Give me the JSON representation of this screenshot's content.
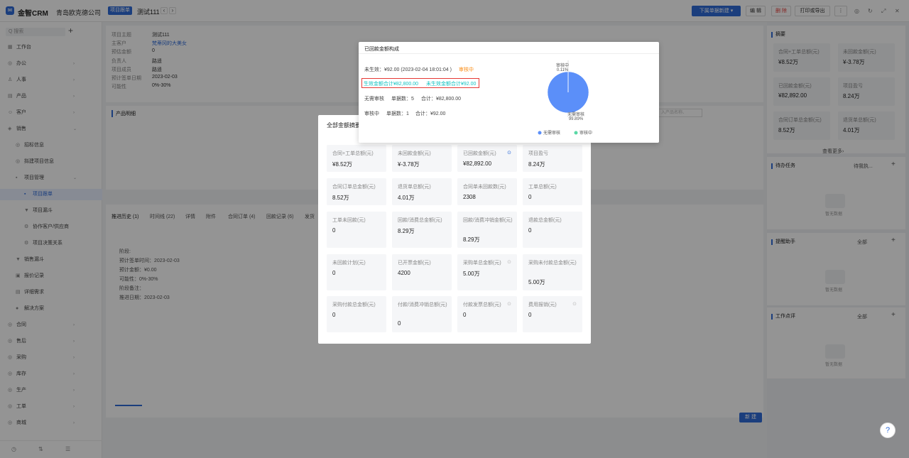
{
  "topbar": {
    "app_name": "金智CRM",
    "company": "青岛欧克德公司",
    "module_tag": "项目跟单",
    "record_title": "测试111",
    "prev": "‹",
    "next": "›",
    "btn_new": "下属单据新建 ▾",
    "btn_edit": "编 辑",
    "btn_delete": "删 除",
    "btn_print": "打印或导出",
    "btn_more": "⋮"
  },
  "sidebar": {
    "search_placeholder": "Q 搜索",
    "plus": "+",
    "items": [
      {
        "label": "工作台",
        "icon": "▦",
        "chevron": ""
      },
      {
        "label": "办公",
        "icon": "◎",
        "chevron": "›"
      },
      {
        "label": "人事",
        "icon": "♙",
        "chevron": "›"
      },
      {
        "label": "产品",
        "icon": "▤",
        "chevron": "›"
      },
      {
        "label": "客户",
        "icon": "☺",
        "chevron": "›"
      },
      {
        "label": "销售",
        "icon": "◈",
        "chevron": "⌄"
      },
      {
        "label": "招标信息",
        "icon": "◎",
        "chevron": ""
      },
      {
        "label": "拟建项目信息",
        "icon": "◎",
        "chevron": ""
      },
      {
        "label": "项目管理",
        "icon": "▪",
        "chevron": "⌄"
      },
      {
        "label": "项目跟单",
        "icon": "▪",
        "chevron": ""
      },
      {
        "label": "项目漏斗",
        "icon": "▼",
        "chevron": ""
      },
      {
        "label": "协作客户/供应商",
        "icon": "⚙",
        "chevron": ""
      },
      {
        "label": "项目决策关系",
        "icon": "⚙",
        "chevron": ""
      },
      {
        "label": "销售漏斗",
        "icon": "▼",
        "chevron": ""
      },
      {
        "label": "报价记录",
        "icon": "▣",
        "chevron": ""
      },
      {
        "label": "详细需求",
        "icon": "▤",
        "chevron": ""
      },
      {
        "label": "解决方案",
        "icon": "●",
        "chevron": ""
      },
      {
        "label": "合同",
        "icon": "◎",
        "chevron": "›"
      },
      {
        "label": "售后",
        "icon": "◎",
        "chevron": "›"
      },
      {
        "label": "采购",
        "icon": "◎",
        "chevron": "›"
      },
      {
        "label": "库存",
        "icon": "◎",
        "chevron": "›"
      },
      {
        "label": "生产",
        "icon": "◎",
        "chevron": "›"
      },
      {
        "label": "工单",
        "icon": "◎",
        "chevron": "›"
      },
      {
        "label": "商城",
        "icon": "◎",
        "chevron": "›"
      }
    ]
  },
  "detail": {
    "fields": [
      {
        "label": "项目主题",
        "value": "测试111"
      },
      {
        "label": "主客户",
        "value": "梵蒂冈的大美女"
      },
      {
        "label": "预估金额",
        "value": "0"
      },
      {
        "label": "负责人",
        "value": "路遥"
      },
      {
        "label": "项目成员",
        "value": "路遥"
      },
      {
        "label": "预计签单日期",
        "value": "2023-02-03"
      },
      {
        "label": "可能性",
        "value": "0%-30%"
      }
    ],
    "product_section": "产品明细",
    "product_search": "入产品名称、",
    "tabs": [
      "推进历史 (1)",
      "时间线 (22)",
      "详情",
      "附件",
      "合同订单 (4)",
      "回款记录 (6)",
      "发货"
    ],
    "new_btn": "新 建",
    "stage_lines": [
      "阶段:",
      "预计签单时间：2023-02-03",
      "预计金额：¥0.00",
      "可能性：0%-30%",
      "阶段备注：",
      "推进日期：2023-02-03"
    ]
  },
  "right_panel": {
    "summary_title": "摘要",
    "summary": [
      {
        "label": "合同+工单总额(元)",
        "value": "¥8.52万"
      },
      {
        "label": "未回款金额(元)",
        "value": "¥-3.78万"
      },
      {
        "label": "已回款金额(元)",
        "value": "¥82,892.00"
      },
      {
        "label": "项目盈亏",
        "value": "8.24万"
      },
      {
        "label": "合同订单总金额(元)",
        "value": "8.52万"
      },
      {
        "label": "退货单总额(元)",
        "value": "4.01万"
      }
    ],
    "view_more": "查看更多›",
    "todo_title": "待办任务",
    "todo_filter": "待我执...",
    "remind_title": "提醒助手",
    "remind_filter": "全部",
    "comment_title": "工作点评",
    "comment_filter": "全部",
    "empty": "暂无数据",
    "plus": "+"
  },
  "modal": {
    "title": "全部金额摘要",
    "items": [
      {
        "label": "合同+工单总额(元)",
        "value": "¥8.52万",
        "info": ""
      },
      {
        "label": "未回款金额(元)",
        "value": "¥-3.78万",
        "info": ""
      },
      {
        "label": "已回款金额(元)",
        "value": "¥82,892.00",
        "info": "⊙"
      },
      {
        "label": "项目盈亏",
        "value": "8.24万",
        "info": ""
      },
      {
        "label": "合同订单总金额(元)",
        "value": "8.52万",
        "info": ""
      },
      {
        "label": "退货单总额(元)",
        "value": "4.01万",
        "info": ""
      },
      {
        "label": "合同单未回款数(元)",
        "value": "2308",
        "info": ""
      },
      {
        "label": "工单总额(元)",
        "value": "0",
        "info": ""
      },
      {
        "label": "工单未回款(元)",
        "value": "0",
        "info": ""
      },
      {
        "label": "回款/消费总金额(元)",
        "value": "8.29万",
        "info": ""
      },
      {
        "label": "回款/消费冲销金额(元)",
        "value": "8.29万",
        "info": ""
      },
      {
        "label": "退款总金额(元)",
        "value": "0",
        "info": ""
      },
      {
        "label": "未回款计划(元)",
        "value": "0",
        "info": ""
      },
      {
        "label": "已开票金额(元)",
        "value": "4200",
        "info": ""
      },
      {
        "label": "采购单总金额(元)",
        "value": "5.00万",
        "info": "⊙"
      },
      {
        "label": "采购未付款总金额(元)",
        "value": "5.00万",
        "info": ""
      },
      {
        "label": "采购付款总金额(元)",
        "value": "0",
        "info": ""
      },
      {
        "label": "付款/消费冲销总额(元)",
        "value": "0",
        "info": ""
      },
      {
        "label": "付款发票总额(元)",
        "value": "0",
        "info": "⊙"
      },
      {
        "label": "费用报销(元)",
        "value": "0",
        "info": "⊙"
      }
    ]
  },
  "popover": {
    "title": "已回款金额构成",
    "pending_line": "未生效：¥92.00 (2023-02-04 18:01:04 )",
    "pending_status": "审核中",
    "effective_total": "生效金额合计¥82,800.00",
    "ineffective_total": "未生效金额合计¥92.00",
    "no_review": "无需审核",
    "no_review_count": "单据数：5",
    "no_review_sum": "合计：¥82,800.00",
    "reviewing": "审核中",
    "reviewing_count": "单据数：1",
    "reviewing_sum": "合计：¥92.00",
    "pie_label_top": "审核中",
    "pie_pct_top": "0.11%",
    "pie_label_bottom": "无需审核",
    "pie_pct_bottom": "99.89%",
    "legend": [
      "无需审核",
      "审核中"
    ],
    "colors": {
      "no_review": "#5b8ff9",
      "reviewing": "#5ad8a6",
      "pending": "#fa8c16",
      "effective": "#13c2c2"
    }
  },
  "chart_data": {
    "type": "pie",
    "title": "已回款金额构成",
    "categories": [
      "无需审核",
      "审核中"
    ],
    "values": [
      99.89,
      0.11
    ],
    "legend": "bottom"
  },
  "help": "?"
}
